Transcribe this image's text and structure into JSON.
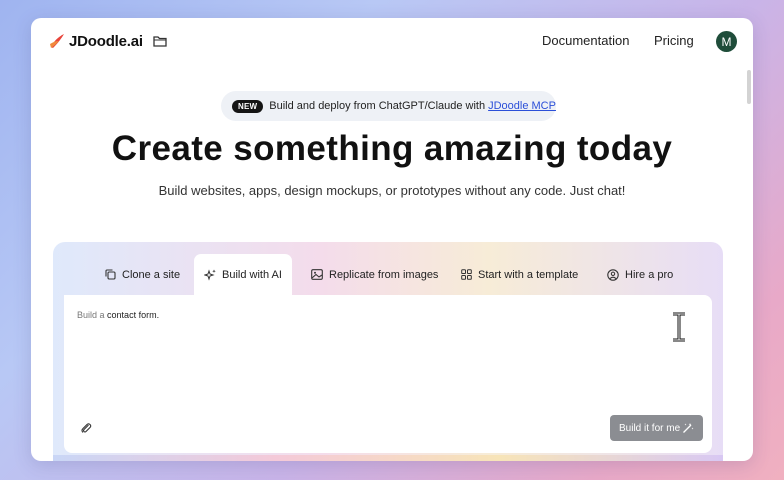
{
  "nav": {
    "logo_text": "JDoodle.ai",
    "links": [
      "Documentation",
      "Pricing"
    ],
    "avatar_initial": "M"
  },
  "announcement": {
    "badge": "NEW",
    "text": "Build and deploy from ChatGPT/Claude with",
    "link_text": "JDoodle MCP"
  },
  "hero": {
    "title": "Create something amazing today",
    "subtitle": "Build websites, apps, design mockups, or prototypes without any code. Just chat!"
  },
  "tabs": [
    {
      "label": "Clone a site",
      "icon": "copy-icon",
      "active": false
    },
    {
      "label": "Build with AI",
      "icon": "sparkle-icon",
      "active": true
    },
    {
      "label": "Replicate from images",
      "icon": "image-icon",
      "active": false
    },
    {
      "label": "Start with a template",
      "icon": "grid-icon",
      "active": false
    },
    {
      "label": "Hire a pro",
      "icon": "user-circle-icon",
      "active": false
    }
  ],
  "editor": {
    "placeholder_prefix": "Build a",
    "placeholder_typed": "contact form.",
    "build_button": "Build it for me"
  },
  "colors": {
    "avatar": "#1f4d3a",
    "link": "#2b4fd8",
    "button": "#8b8d92",
    "logo_accent": "#e8443a"
  }
}
